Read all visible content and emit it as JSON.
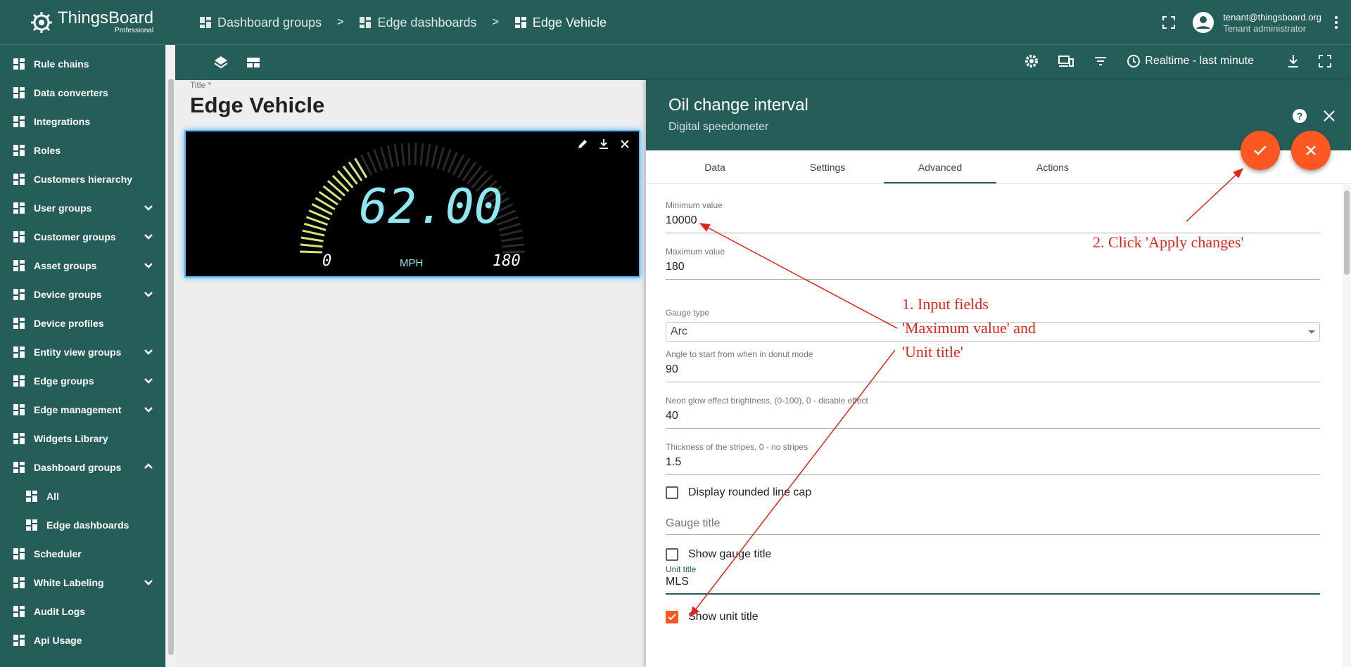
{
  "brand": {
    "name": "ThingsBoard",
    "edition": "Professional"
  },
  "sidebar": {
    "items": [
      {
        "label": "Rule chains",
        "icon": "rule-chains-icon",
        "chevron": ""
      },
      {
        "label": "Data converters",
        "icon": "crop-icon",
        "chevron": ""
      },
      {
        "label": "Integrations",
        "icon": "integrations-icon",
        "chevron": ""
      },
      {
        "label": "Roles",
        "icon": "shield-icon",
        "chevron": ""
      },
      {
        "label": "Customers hierarchy",
        "icon": "sort-icon",
        "chevron": ""
      },
      {
        "label": "User groups",
        "icon": "account-circle-icon",
        "chevron": "down"
      },
      {
        "label": "Customer groups",
        "icon": "supervisor-icon",
        "chevron": "down"
      },
      {
        "label": "Asset groups",
        "icon": "domain-icon",
        "chevron": "down"
      },
      {
        "label": "Device groups",
        "icon": "devices-icon",
        "chevron": "down"
      },
      {
        "label": "Device profiles",
        "icon": "device-profile-icon",
        "chevron": ""
      },
      {
        "label": "Entity view groups",
        "icon": "view-quilt-icon",
        "chevron": "down"
      },
      {
        "label": "Edge groups",
        "icon": "router-icon",
        "chevron": "down"
      },
      {
        "label": "Edge management",
        "icon": "settings-input-antenna-icon",
        "chevron": "down"
      },
      {
        "label": "Widgets Library",
        "icon": "widgets-icon",
        "chevron": ""
      },
      {
        "label": "Dashboard groups",
        "icon": "dashboard-icon",
        "chevron": "up"
      },
      {
        "label": "All",
        "icon": "dashboard-icon",
        "chevron": "",
        "sub": true
      },
      {
        "label": "Edge dashboards",
        "icon": "dashboard-icon",
        "chevron": "",
        "sub": true
      },
      {
        "label": "Scheduler",
        "icon": "schedule-icon",
        "chevron": ""
      },
      {
        "label": "White Labeling",
        "icon": "format-paint-icon",
        "chevron": "down"
      },
      {
        "label": "Audit Logs",
        "icon": "track-changes-icon",
        "chevron": ""
      },
      {
        "label": "Api Usage",
        "icon": "insert-chart-icon",
        "chevron": ""
      }
    ]
  },
  "breadcrumb": {
    "items": [
      "Dashboard groups",
      "Edge dashboards",
      "Edge Vehicle"
    ],
    "separator": ">"
  },
  "user": {
    "email": "tenant@thingsboard.org",
    "role": "Tenant administrator"
  },
  "toolbar": {
    "timewindow": "Realtime - last minute"
  },
  "dashboard": {
    "title_label": "Title *",
    "title": "Edge Vehicle",
    "gauge": {
      "value": "62.00",
      "min": "0",
      "max": "180",
      "unit": "MPH",
      "fraction": 0.34
    }
  },
  "panel": {
    "title": "Oil change interval",
    "subtitle": "Digital speedometer",
    "tabs": [
      "Data",
      "Settings",
      "Advanced",
      "Actions"
    ],
    "active_tab": "Advanced",
    "fields": {
      "min_label": "Minimum value",
      "min_value": "10000",
      "max_label": "Maximum value",
      "max_value": "180",
      "gauge_type_label": "Gauge type",
      "gauge_type_value": "Arc",
      "angle_label": "Angle to start from when in donut mode",
      "angle_value": "90",
      "neon_label": "Neon glow effect brightness, (0-100), 0 - disable effect",
      "neon_value": "40",
      "stripes_label": "Thickness of the stripes, 0 - no stripes",
      "stripes_value": "1.5",
      "rounded_label": "Display rounded line cap",
      "gauge_title_placeholder": "Gauge title",
      "show_gauge_title_label": "Show gauge title",
      "unit_title_label": "Unit title",
      "unit_title_value": "MLS",
      "show_unit_title_label": "Show unit title"
    }
  },
  "annotations": {
    "step1_line1": "1. Input fields",
    "step1_line2": "'Maximum value' and",
    "step1_line3": "'Unit title'",
    "step2": "2. Click 'Apply changes'"
  },
  "colors": {
    "primary": "#255d58",
    "accent": "#ff5722",
    "annotation": "#e0251b",
    "gauge_active": "#d4e57a",
    "gauge_digits": "#8fe7f0"
  }
}
